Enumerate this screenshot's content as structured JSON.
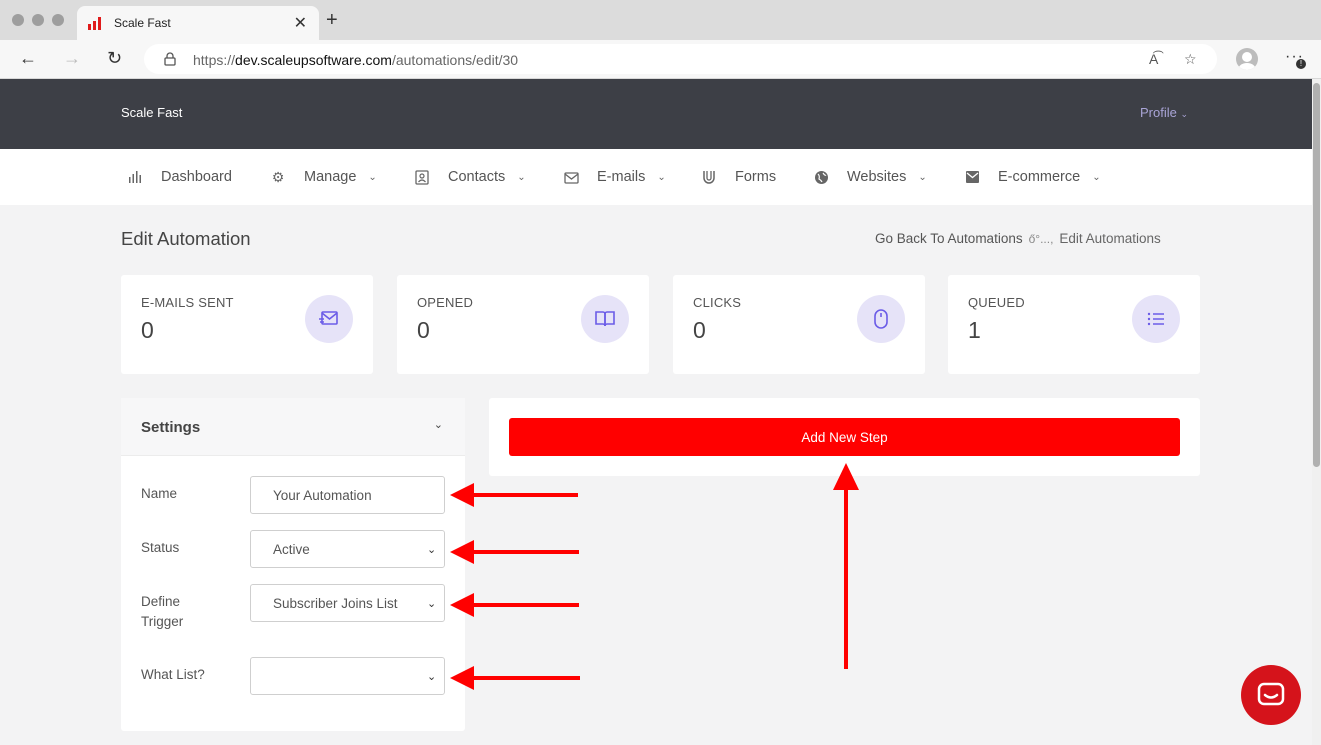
{
  "browser": {
    "tab_title": "Scale Fast",
    "tab_close": "✕",
    "new_tab": "+",
    "url_prefix": "https://",
    "url_host": "dev.scaleupsoftware.com",
    "url_path": "/automations/edit/30"
  },
  "app": {
    "brand": "Scale Fast",
    "profile": "Profile"
  },
  "menu": [
    {
      "label": "Dashboard",
      "icon": "bar-chart-icon",
      "dropdown": false
    },
    {
      "label": "Manage",
      "icon": "gear-icon",
      "dropdown": true
    },
    {
      "label": "Contacts",
      "icon": "contact-card-icon",
      "dropdown": true
    },
    {
      "label": "E-mails",
      "icon": "email-icon",
      "dropdown": true
    },
    {
      "label": "Forms",
      "icon": "magnet-icon",
      "dropdown": false
    },
    {
      "label": "Websites",
      "icon": "globe-icon",
      "dropdown": true
    },
    {
      "label": "E-commerce",
      "icon": "envelope-box-icon",
      "dropdown": true
    }
  ],
  "page": {
    "title": "Edit Automation",
    "breadcrumb": {
      "back": "Go Back To Automations",
      "separator": "ő°...,",
      "current": "Edit Automations"
    }
  },
  "stats": [
    {
      "label": "E-MAILS SENT",
      "value": "0",
      "icon": "mail-send-icon"
    },
    {
      "label": "OPENED",
      "value": "0",
      "icon": "open-book-icon"
    },
    {
      "label": "CLICKS",
      "value": "0",
      "icon": "mouse-icon"
    },
    {
      "label": "QUEUED",
      "value": "1",
      "icon": "list-icon"
    }
  ],
  "settings": {
    "title": "Settings",
    "name_label": "Name",
    "name_value": "Your Automation",
    "status_label": "Status",
    "status_value": "Active",
    "trigger_label": "Define Trigger",
    "trigger_value": "Subscriber Joins List",
    "list_label": "What List?",
    "list_value": ""
  },
  "steps": {
    "add_label": "Add New Step"
  },
  "colors": {
    "header_bg": "#3d3f46",
    "accent_purple": "#6b5ce7",
    "icon_circle": "#e6e3f8",
    "add_button": "#ff0000",
    "annotation_arrow": "#ff0000",
    "chat_button": "#d5131b"
  }
}
